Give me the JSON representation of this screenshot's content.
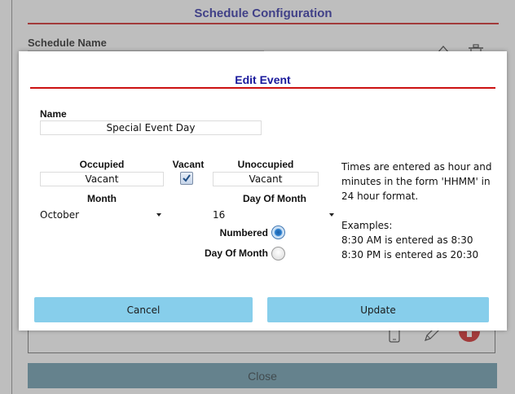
{
  "background": {
    "title": "Schedule Configuration",
    "schedule_name_label": "Schedule Name",
    "close_label": "Close",
    "icons": [
      "home-icon",
      "trash-icon",
      "phone-icon",
      "pencil-icon",
      "add-icon"
    ]
  },
  "dialog": {
    "title": "Edit Event",
    "name_label": "Name",
    "name_value": "Special Event Day",
    "occupied_label": "Occupied",
    "occupied_value": "Vacant",
    "vacant_label": "Vacant",
    "vacant_checked": true,
    "unoccupied_label": "Unoccupied",
    "unoccupied_value": "Vacant",
    "month_label": "Month",
    "month_value": "October",
    "day_of_month_label": "Day Of Month",
    "day_of_month_value": "16",
    "numbered_label": "Numbered",
    "numbered_selected": true,
    "day_of_month_radio_label": "Day Of Month",
    "help": {
      "line1": "Times are entered as hour and minutes in the form 'HHMM' in 24 hour format.",
      "line2": "Examples:",
      "line3": "8:30 AM is entered as 8:30",
      "line4": "8:30 PM is entered as 20:30"
    },
    "cancel_label": "Cancel",
    "update_label": "Update"
  },
  "colors": {
    "title_text": "#1a1a9c",
    "title_rule": "#cc1111",
    "button": "#87ceeb",
    "close_button": "#5e93a6",
    "add_icon": "#cc1111"
  }
}
